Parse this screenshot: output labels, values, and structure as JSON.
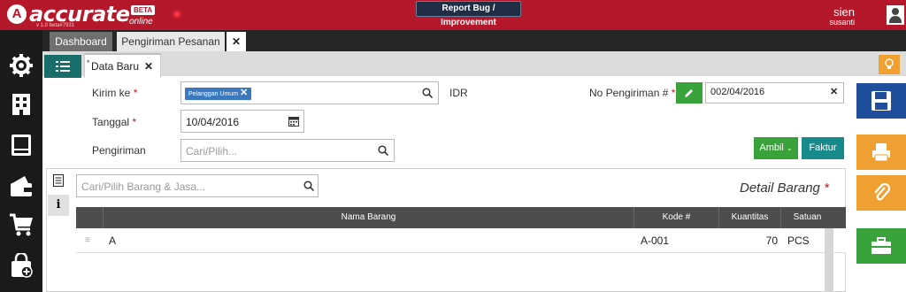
{
  "app": {
    "logo_mark": "A",
    "logo_text": "accurate",
    "beta_badge": "BETA",
    "online_text": "online",
    "version": "v 1.0 beta#7931",
    "report_bug": "Report Bug / Improvement",
    "user_name": "sien",
    "user_sub": "susanti"
  },
  "tabs": [
    {
      "label": "Dashboard"
    },
    {
      "label": "Pengiriman Pesanan"
    }
  ],
  "tab_close": "✕",
  "subtab": {
    "label": "Data Baru",
    "close": "✕",
    "modified_mark": "*"
  },
  "sidebar_icons": [
    "gear-icon",
    "building-icon",
    "book-icon",
    "wallet-icon",
    "cart-icon",
    "bag-plus-icon"
  ],
  "form": {
    "kirim_ke_label": "Kirim ke",
    "required_mark": "*",
    "kirim_ke_tag": "Pelanggan Umum",
    "currency": "IDR",
    "no_pengiriman_label": "No Pengiriman #",
    "no_pengiriman_value": "002/04/2016",
    "tanggal_label": "Tanggal",
    "tanggal_value": "10/04/2016",
    "pengiriman_label": "Pengiriman",
    "pengiriman_placeholder": "Cari/Pilih..."
  },
  "buttons": {
    "ambil": "Ambil",
    "faktur": "Faktur"
  },
  "detail": {
    "search_placeholder": "Cari/Pilih Barang & Jasa...",
    "title": "Detail Barang",
    "columns": [
      "Nama Barang",
      "Kode #",
      "Kuantitas",
      "Satuan"
    ],
    "rows": [
      {
        "nama": "A",
        "kode": "A-001",
        "qty": "70",
        "satuan": "PCS"
      }
    ]
  },
  "colors": {
    "brand": "#b5182a",
    "sidebar": "#1a1a1a",
    "save": "#1f4f9c",
    "accent_orange": "#f0a030",
    "green": "#3aa23a",
    "teal": "#178b8b"
  }
}
